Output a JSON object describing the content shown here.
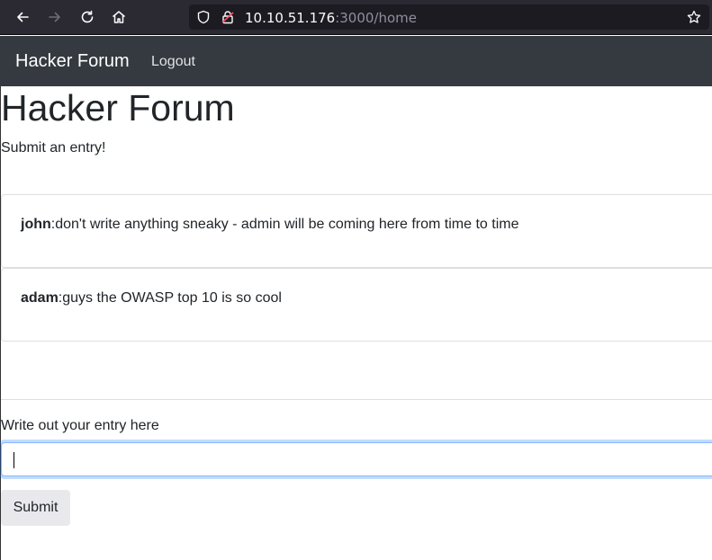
{
  "browser": {
    "url_host": "10.10.51.176",
    "url_path": ":3000/home"
  },
  "navbar": {
    "brand": "Hacker Forum",
    "logout_label": "Logout"
  },
  "page": {
    "title": "Hacker Forum",
    "subtitle": "Submit an entry!"
  },
  "posts": [
    {
      "author": "john",
      "message": ":don't write anything sneaky - admin will be coming here from time to time"
    },
    {
      "author": "adam",
      "message": ":guys the OWASP top 10 is so cool"
    }
  ],
  "form": {
    "label": "Write out your entry here",
    "input_value": "",
    "submit_label": "Submit"
  },
  "colors": {
    "browser_chrome": "#2b2a33",
    "navbar": "#343a40",
    "focus_ring": "#86b7fe"
  }
}
